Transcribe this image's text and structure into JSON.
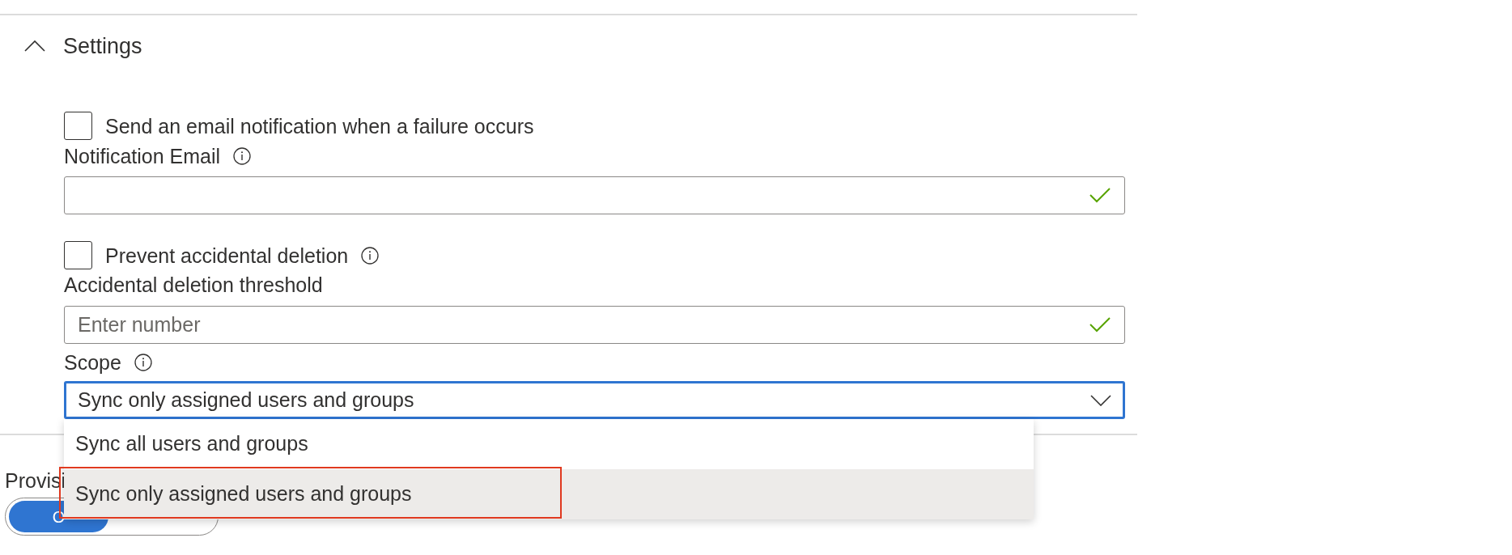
{
  "section": {
    "title": "Settings",
    "expanded": true
  },
  "fields": [
    {
      "kind": "checkbox",
      "label": "Send an email notification when a failure occurs",
      "checked": false
    },
    {
      "kind": "label",
      "label": "Notification Email",
      "info": true
    },
    {
      "kind": "textbox",
      "valid": true
    },
    {
      "kind": "checkbox",
      "label": "Prevent accidental deletion",
      "checked": false,
      "info": true
    },
    {
      "kind": "label",
      "label": "Accidental deletion threshold"
    },
    {
      "kind": "textbox",
      "placeholder": "Enter number",
      "valid": true
    },
    {
      "kind": "label",
      "label": "Scope",
      "info": true
    },
    {
      "kind": "select",
      "value": "Sync only assigned users and groups",
      "focused": true,
      "options": [
        {
          "label": "Sync all users and groups",
          "selected": false,
          "annotated": false
        },
        {
          "label": "Sync only assigned users and groups",
          "selected": true,
          "annotated": true
        }
      ]
    }
  ],
  "provisioning": {
    "label": "Provisi",
    "toggle": [
      {
        "label": "O",
        "selected": true
      }
    ]
  }
}
